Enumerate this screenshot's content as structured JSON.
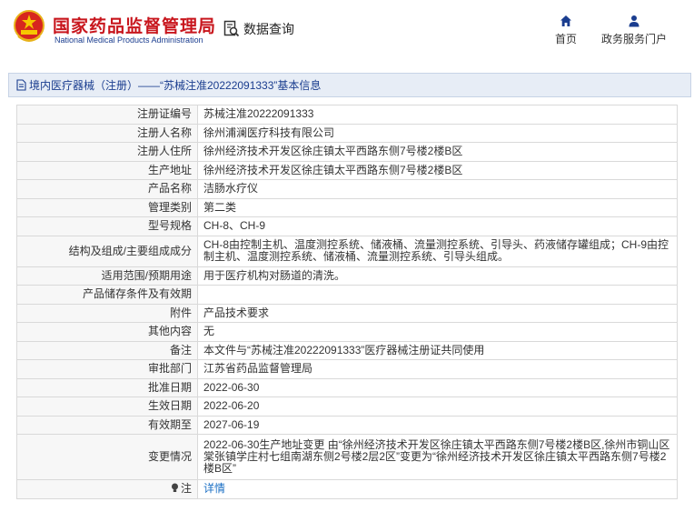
{
  "header": {
    "brand_cn": "国家药品监督管理局",
    "brand_en": "National Medical Products Administration",
    "query_label": "数据查询",
    "nav": [
      {
        "label": "首页",
        "icon": "home-icon"
      },
      {
        "label": "政务服务门户",
        "icon": "user-icon"
      }
    ]
  },
  "colors": {
    "brand_red": "#c8161d",
    "brand_blue": "#1a3d8f",
    "link_blue": "#1a6fc4",
    "titlebar_bg": "#e7edf6"
  },
  "title_bar": {
    "text": "境内医疗器械（注册）——“苏械注准20222091333”基本信息"
  },
  "rows": [
    {
      "label": "注册证编号",
      "value": "苏械注准20222091333"
    },
    {
      "label": "注册人名称",
      "value": "徐州浦澜医疗科技有限公司"
    },
    {
      "label": "注册人住所",
      "value": "徐州经济技术开发区徐庄镇太平西路东侧7号楼2楼B区"
    },
    {
      "label": "生产地址",
      "value": "徐州经济技术开发区徐庄镇太平西路东侧7号楼2楼B区"
    },
    {
      "label": "产品名称",
      "value": "洁肠水疗仪"
    },
    {
      "label": "管理类别",
      "value": "第二类"
    },
    {
      "label": "型号规格",
      "value": "CH-8、CH-9"
    },
    {
      "label": "结构及组成/主要组成成分",
      "value": "CH-8由控制主机、温度测控系统、储液桶、流量测控系统、引导头、药液储存罐组成；CH-9由控制主机、温度测控系统、储液桶、流量测控系统、引导头组成。"
    },
    {
      "label": "适用范围/预期用途",
      "value": "用于医疗机构对肠道的清洗。"
    },
    {
      "label": "产品储存条件及有效期",
      "value": ""
    },
    {
      "label": "附件",
      "value": "产品技术要求"
    },
    {
      "label": "其他内容",
      "value": "无"
    },
    {
      "label": "备注",
      "value": "本文件与“苏械注准20222091333”医疗器械注册证共同使用"
    },
    {
      "label": "审批部门",
      "value": "江苏省药品监督管理局"
    },
    {
      "label": "批准日期",
      "value": "2022-06-30"
    },
    {
      "label": "生效日期",
      "value": "2022-06-20"
    },
    {
      "label": "有效期至",
      "value": "2027-06-19"
    },
    {
      "label": "变更情况",
      "value": "2022-06-30生产地址变更 由“徐州经济技术开发区徐庄镇太平西路东侧7号楼2楼B区,徐州市铜山区棠张镇学庄村七组南湖东侧2号楼2层2区”变更为“徐州经济技术开发区徐庄镇太平西路东侧7号楼2楼B区”"
    },
    {
      "label": "注",
      "value": "详情"
    }
  ]
}
